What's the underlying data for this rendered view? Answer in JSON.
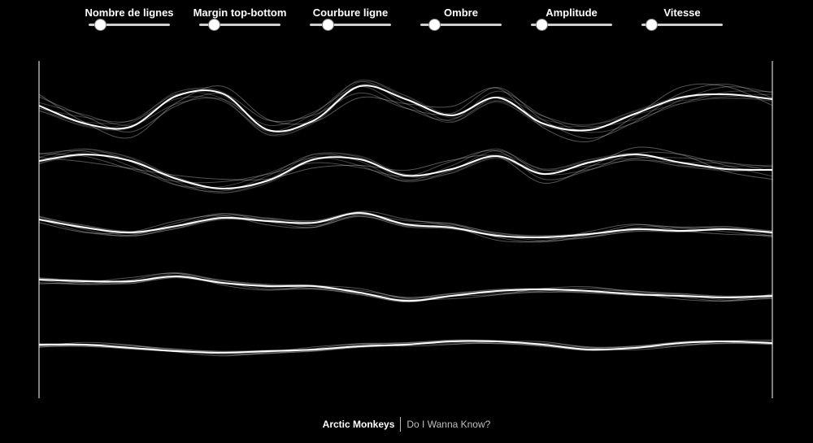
{
  "controls": [
    {
      "label": "Nombre de lignes",
      "value": 0.14
    },
    {
      "label": "Margin top-bottom",
      "value": 0.18
    },
    {
      "label": "Courbure ligne",
      "value": 0.22
    },
    {
      "label": "Ombre",
      "value": 0.17
    },
    {
      "label": "Amplitude",
      "value": 0.13
    },
    {
      "label": "Vitesse",
      "value": 0.12
    }
  ],
  "now_playing": {
    "artist": "Arctic Monkeys",
    "song": "Do I Wanna Know?"
  },
  "colors": {
    "background": "#000000",
    "line": "#ffffff",
    "track": "#cfcfcf"
  }
}
